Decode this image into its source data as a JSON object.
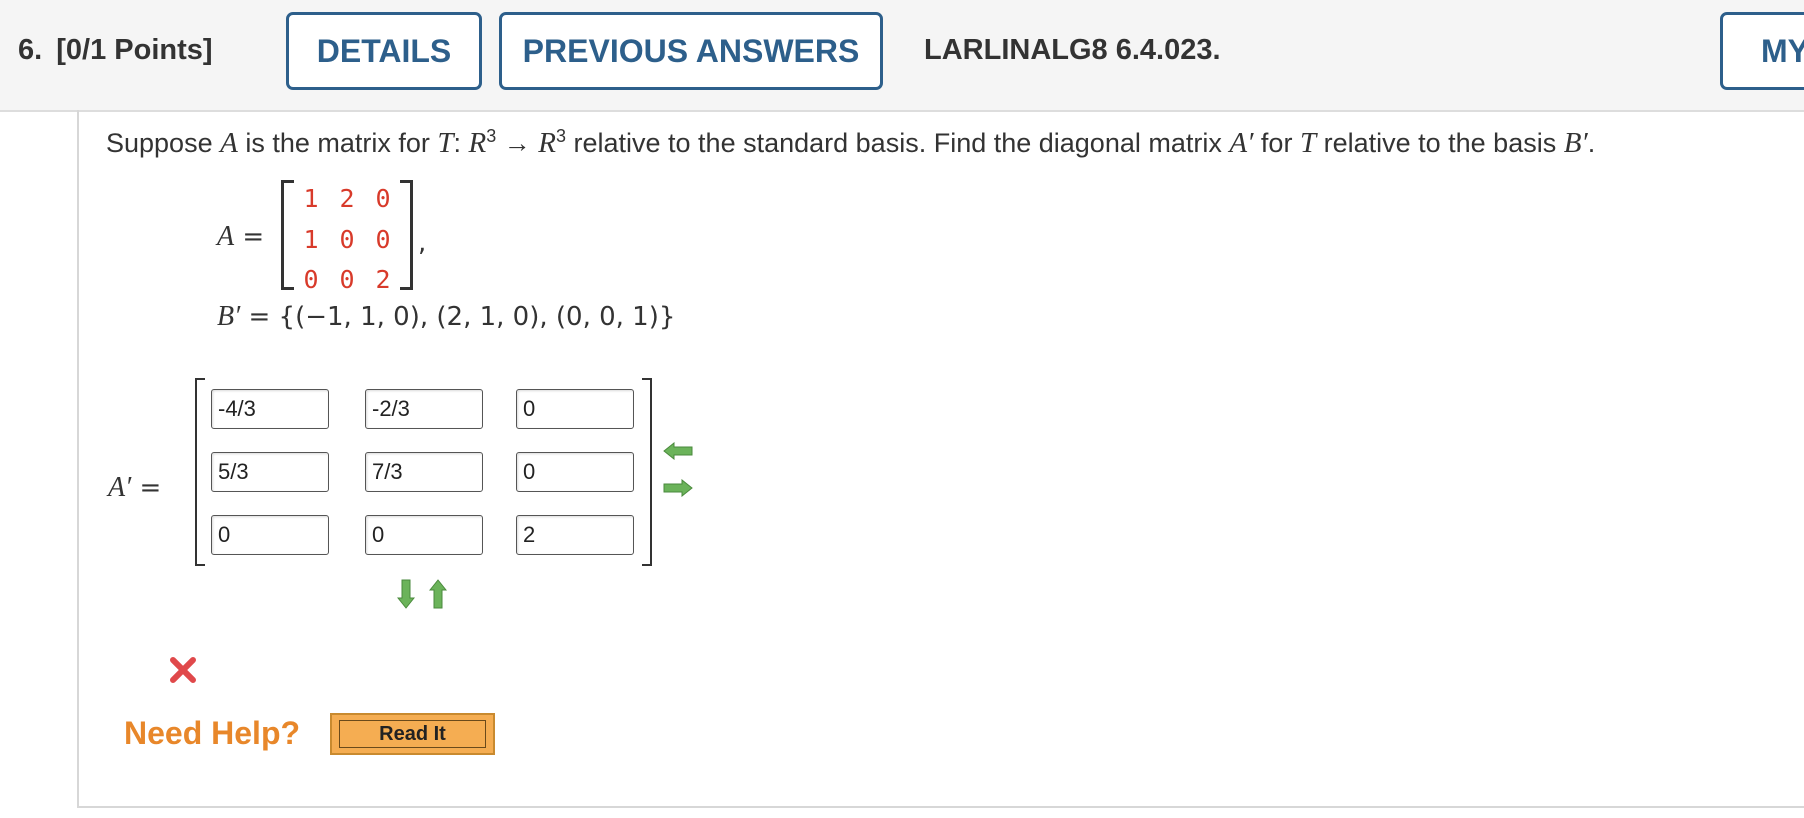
{
  "header": {
    "question_number": "6.",
    "points": "[0/1 Points]",
    "details_label": "DETAILS",
    "previous_answers_label": "PREVIOUS ANSWERS",
    "reference": "LARLINALG8 6.4.023.",
    "my_notes_label": "MY"
  },
  "question": {
    "prompt": {
      "p1": "Suppose ",
      "A": "A",
      "p2": " is the matrix for ",
      "T": "T",
      "colon": ": ",
      "R": "R",
      "exp": "3",
      "arrow": " → ",
      "p3": " relative to the standard basis. Find the diagonal matrix ",
      "Aprime": "A′",
      "p4": " for ",
      "p5": " relative to the basis ",
      "Bprime": "B′",
      "end": "."
    },
    "matrix_label": "A",
    "equals": " =",
    "comma": ",",
    "matrix_A": [
      [
        "1",
        "2",
        "0"
      ],
      [
        "1",
        "0",
        "0"
      ],
      [
        "0",
        "0",
        "2"
      ]
    ],
    "basis_label": "B′",
    "basis_text": " = {(−1, 1, 0), (2, 1, 0), (0, 0, 1)}"
  },
  "answer": {
    "label": "A′",
    "equals": " =",
    "values": [
      [
        "-4/3",
        "-2/3",
        "0"
      ],
      [
        "5/3",
        "7/3",
        "0"
      ],
      [
        "0",
        "0",
        "2"
      ]
    ]
  },
  "feedback": {
    "status": "incorrect"
  },
  "help": {
    "need_help": "Need Help?",
    "read_it": "Read It"
  },
  "colors": {
    "matrix_entries": "#d83a2a",
    "buttons": "#2d5f8b",
    "help": "#e8872a",
    "arrows": "#6bb35a"
  },
  "icons": [
    "insert-column-arrow-icon",
    "remove-column-arrow-icon",
    "remove-row-arrow-icon",
    "insert-row-arrow-icon",
    "incorrect-x-icon"
  ]
}
